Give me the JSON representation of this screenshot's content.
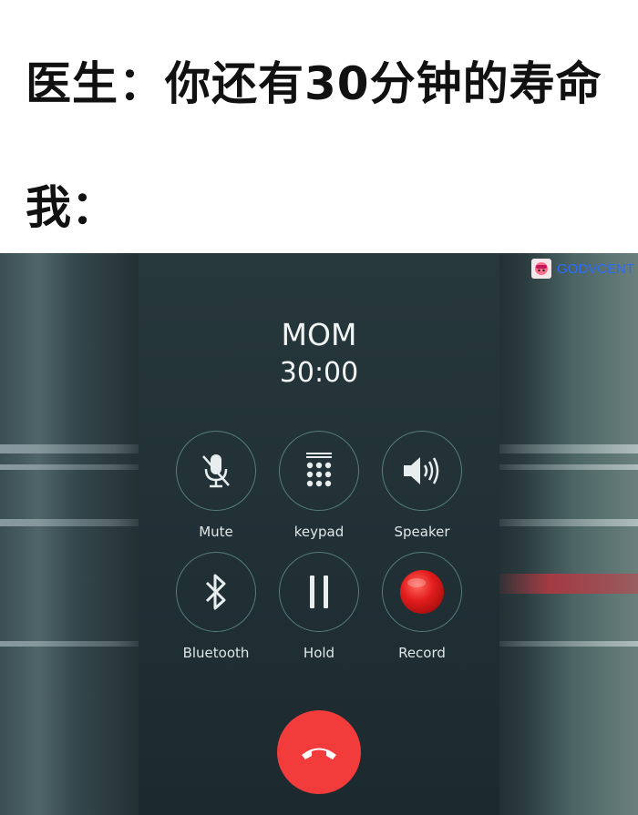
{
  "meme": {
    "line1": "医生：你还有30分钟的寿命",
    "line2": "我："
  },
  "watermark": {
    "text": "GODVCENT",
    "icon": "watermark-logo-icon"
  },
  "call": {
    "caller": "MOM",
    "timer": "30:00"
  },
  "controls": [
    {
      "label": "Mute",
      "icon": "microphone-muted-icon"
    },
    {
      "label": "keypad",
      "icon": "keypad-icon"
    },
    {
      "label": "Speaker",
      "icon": "speaker-icon"
    },
    {
      "label": "Bluetooth",
      "icon": "bluetooth-icon"
    },
    {
      "label": "Hold",
      "icon": "pause-icon"
    },
    {
      "label": "Record",
      "icon": "record-icon"
    }
  ],
  "colors": {
    "end_call": "#f23b3b",
    "record": "#e31d1d",
    "watermark_text": "#2b6cff"
  }
}
